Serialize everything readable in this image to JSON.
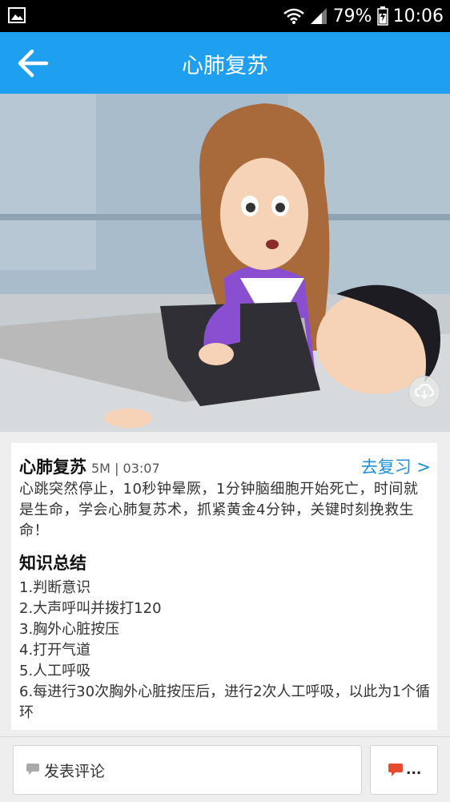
{
  "status_bar": {
    "battery": "79%",
    "time": "10:06"
  },
  "header": {
    "title": "心肺复苏"
  },
  "lesson": {
    "title": "心肺复苏",
    "meta": "5M | 03:07",
    "review_link": "去复习 >",
    "description": "心跳突然停止，10秒钟晕厥，1分钟脑细胞开始死亡，时间就是生命，学会心肺复苏术，抓紧黄金4分钟，关键时刻挽救生命！"
  },
  "summary": {
    "title": "知识总结",
    "items": [
      "1.判断意识",
      "2.大声呼叫并拨打120",
      "3.胸外心脏按压",
      "4.打开气道",
      "5.人工呼吸",
      "6.每进行30次胸外心脏按压后，进行2次人工呼吸，以此为1个循环"
    ]
  },
  "bottom_bar": {
    "comment_placeholder": "发表评论",
    "comment_count": "..."
  },
  "colors": {
    "accent": "#1f9ff0",
    "link": "#1f8fd6",
    "comment_icon": "#e84a2f"
  },
  "icons": [
    "image-icon",
    "wifi-icon",
    "signal-icon",
    "battery-icon",
    "back-arrow-icon",
    "cloud-download-icon",
    "comment-icon",
    "comment-count-icon"
  ]
}
